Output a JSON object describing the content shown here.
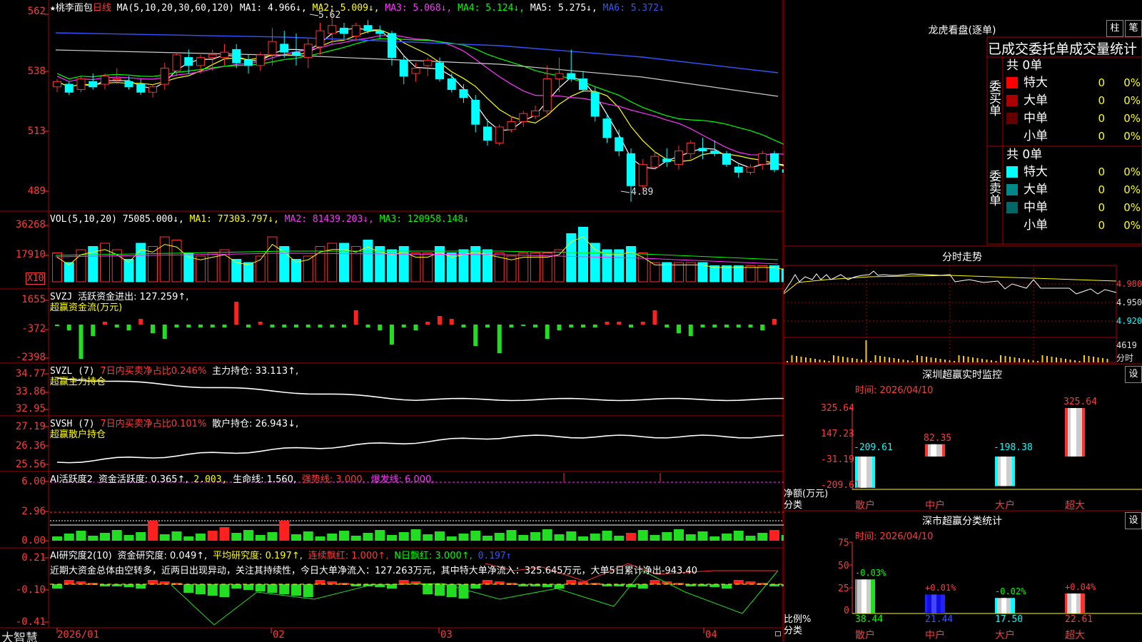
{
  "colors": {
    "up": "#ff3030",
    "down": "#00ffff",
    "ma1": "#ffffff",
    "ma2": "#ffff00",
    "ma3": "#ff33ff",
    "ma4": "#00ff00",
    "ma5": "#cccccc",
    "ma6": "#3355ff",
    "grid": "#880000"
  },
  "main": {
    "star_icon": "star-icon",
    "stock_name": "★桃李面包",
    "period": "日线",
    "ma_label": "MA(5,10,20,30,60,120)",
    "ma1": "MA1: 4.966↓,",
    "ma2": "MA2: 5.009↓,",
    "ma3": "MA3: 5.068↓,",
    "ma4": "MA4: 5.124↓,",
    "ma5": "MA5: 5.275↓,",
    "ma6": "MA6: 5.372↓",
    "y_ticks": [
      "562",
      "538",
      "513",
      "489"
    ],
    "high_marker": "5.62",
    "low_marker": "4.89"
  },
  "chart_data": [
    {
      "type": "candlestick",
      "title": "桃李面包 日线",
      "ylim": [
        4.86,
        5.64
      ],
      "ohlc_approx": [
        [
          5.32,
          5.35,
          5.3,
          5.34
        ],
        [
          5.33,
          5.34,
          5.29,
          5.3
        ],
        [
          5.31,
          5.36,
          5.3,
          5.35
        ],
        [
          5.34,
          5.37,
          5.31,
          5.32
        ],
        [
          5.33,
          5.37,
          5.31,
          5.36
        ],
        [
          5.35,
          5.39,
          5.33,
          5.35
        ],
        [
          5.34,
          5.36,
          5.31,
          5.32
        ],
        [
          5.33,
          5.35,
          5.29,
          5.3
        ],
        [
          5.3,
          5.33,
          5.28,
          5.32
        ],
        [
          5.33,
          5.41,
          5.31,
          5.39
        ],
        [
          5.38,
          5.45,
          5.36,
          5.44
        ],
        [
          5.43,
          5.46,
          5.37,
          5.4
        ],
        [
          5.4,
          5.44,
          5.37,
          5.43
        ],
        [
          5.43,
          5.46,
          5.38,
          5.44
        ],
        [
          5.43,
          5.48,
          5.4,
          5.45
        ],
        [
          5.46,
          5.48,
          5.39,
          5.41
        ],
        [
          5.42,
          5.44,
          5.37,
          5.4
        ],
        [
          5.4,
          5.45,
          5.38,
          5.44
        ],
        [
          5.44,
          5.54,
          5.4,
          5.49
        ],
        [
          5.48,
          5.53,
          5.43,
          5.45
        ],
        [
          5.45,
          5.52,
          5.4,
          5.44
        ],
        [
          5.43,
          5.5,
          5.39,
          5.48
        ],
        [
          5.47,
          5.56,
          5.44,
          5.53
        ],
        [
          5.52,
          5.62,
          5.48,
          5.55
        ],
        [
          5.54,
          5.56,
          5.5,
          5.52
        ],
        [
          5.51,
          5.56,
          5.49,
          5.55
        ],
        [
          5.55,
          5.57,
          5.52,
          5.53
        ],
        [
          5.53,
          5.55,
          5.5,
          5.52
        ],
        [
          5.52,
          5.53,
          5.4,
          5.43
        ],
        [
          5.42,
          5.44,
          5.33,
          5.36
        ],
        [
          5.37,
          5.41,
          5.34,
          5.39
        ],
        [
          5.4,
          5.43,
          5.36,
          5.42
        ],
        [
          5.41,
          5.43,
          5.34,
          5.35
        ],
        [
          5.35,
          5.37,
          5.3,
          5.31
        ],
        [
          5.31,
          5.33,
          5.26,
          5.28
        ],
        [
          5.27,
          5.29,
          5.15,
          5.18
        ],
        [
          5.17,
          5.2,
          5.1,
          5.12
        ],
        [
          5.11,
          5.18,
          5.1,
          5.17
        ],
        [
          5.16,
          5.21,
          5.15,
          5.19
        ],
        [
          5.19,
          5.23,
          5.17,
          5.22
        ],
        [
          5.21,
          5.25,
          5.2,
          5.23
        ],
        [
          5.23,
          5.4,
          5.21,
          5.35
        ],
        [
          5.35,
          5.43,
          5.3,
          5.37
        ],
        [
          5.37,
          5.46,
          5.34,
          5.35
        ],
        [
          5.35,
          5.38,
          5.3,
          5.31
        ],
        [
          5.3,
          5.32,
          5.19,
          5.21
        ],
        [
          5.2,
          5.22,
          5.11,
          5.13
        ],
        [
          5.13,
          5.16,
          5.06,
          5.08
        ],
        [
          5.07,
          5.09,
          4.89,
          4.95
        ],
        [
          4.95,
          5.05,
          4.93,
          5.03
        ],
        [
          5.02,
          5.08,
          5.01,
          5.06
        ],
        [
          5.05,
          5.09,
          5.02,
          5.04
        ],
        [
          5.03,
          5.1,
          5.01,
          5.08
        ],
        [
          5.07,
          5.12,
          5.05,
          5.11
        ],
        [
          5.09,
          5.13,
          5.05,
          5.08
        ],
        [
          5.08,
          5.12,
          5.06,
          5.07
        ],
        [
          5.07,
          5.08,
          5.02,
          5.03
        ],
        [
          5.02,
          5.03,
          4.98,
          5.0
        ],
        [
          5.0,
          5.03,
          4.99,
          5.02
        ],
        [
          5.03,
          5.08,
          5.01,
          5.07
        ],
        [
          5.07,
          5.08,
          5.0,
          5.01
        ],
        [
          5.01,
          5.03,
          4.99,
          5.0
        ]
      ]
    },
    {
      "type": "bar",
      "title": "VOL(5,10,20)",
      "values_rel": [
        0.45,
        0.3,
        0.5,
        0.55,
        0.6,
        0.5,
        0.35,
        0.6,
        0.55,
        0.7,
        0.65,
        0.45,
        0.4,
        0.45,
        0.5,
        0.35,
        0.3,
        0.4,
        0.7,
        0.55,
        0.35,
        0.4,
        0.55,
        0.6,
        0.6,
        0.55,
        0.65,
        0.55,
        0.5,
        0.55,
        0.45,
        0.45,
        0.55,
        0.45,
        0.5,
        0.55,
        0.5,
        0.45,
        0.4,
        0.45,
        0.45,
        0.45,
        0.5,
        0.75,
        0.85,
        0.6,
        0.5,
        0.5,
        0.55,
        0.45,
        0.3,
        0.3,
        0.3,
        0.3,
        0.3,
        0.25,
        0.25,
        0.25,
        0.25,
        0.25,
        0.25,
        0.2
      ],
      "y_ticks": [
        "36268",
        "17910"
      ],
      "unit": "X10"
    }
  ],
  "vol": {
    "label": "VOL(5,10,20)",
    "value": "75085.000↓,",
    "ma1": "MA1: 77303.797↓,",
    "ma2": "MA2: 81439.203↓,",
    "ma3": "MA3: 120958.148↓",
    "y_ticks": [
      "36268",
      "17910"
    ],
    "unit": "X10"
  },
  "svzj": {
    "label": "SVZJ",
    "desc": "活跃资金进出: 127.259↑,",
    "sub": "超赢资金流(万元)",
    "y_ticks": [
      "1655",
      "-372",
      "-2398"
    ]
  },
  "svzl": {
    "label": "SVZL (7)",
    "desc1": "7日内买卖净占比0.246%",
    "desc2": "主力持仓: 33.113↑,",
    "sub": "超赢主力持仓",
    "y_ticks": [
      "34.77",
      "33.86",
      "32.95"
    ]
  },
  "svsh": {
    "label": "SVSH (7)",
    "desc1": "7日内买卖净占比0.101%",
    "desc2": "散户持仓: 26.943↓,",
    "sub": "超赢散户持仓",
    "y_ticks": [
      "27.19",
      "26.36",
      "25.56"
    ]
  },
  "ai_active": {
    "label": "AI活跃度2",
    "d1": "资金活跃度: 0.365↑,",
    "d2": "2.003,",
    "d3": "生命线: 1.560,",
    "d4": "强势线: 3.000,",
    "d5": "爆发线: 6.000,",
    "y_ticks": [
      "6.00",
      "2.96",
      "0.00"
    ]
  },
  "ai_research": {
    "label": "AI研究度2(10)",
    "d1": "资金研究度: 0.049↑,",
    "d2": "平均研究度: 0.197↑,",
    "d3": "连续飘红: 1.000↑,",
    "d4": "N日飘红: 3.000↑,",
    "d5": "0.197↑",
    "note": "近期大资金总体由空转多，近两日出现异动，关注其持续性，今日大单净流入：127.263万元，其中特大单净流入：325.645万元，大单5日累计净出-943.40",
    "y_ticks": [
      "0.21",
      "-0.10",
      "-0.41"
    ]
  },
  "x_axis": {
    "labels": [
      "2026/01",
      "02",
      "03",
      "04"
    ],
    "brand": "大智慧"
  },
  "right": {
    "longhu_title": "龙虎看盘(逐单)",
    "btn_column": "柱",
    "btn_count": "笔",
    "stat_title": "已成交委托单成交量统计",
    "buy_side": "委买单",
    "sell_side": "委卖单",
    "buy_total": "共 0单",
    "sell_total": "共 0单",
    "buy_rows": [
      {
        "label": "特大",
        "count": "0",
        "pct": "0%",
        "color": "#ff0000"
      },
      {
        "label": "大单",
        "count": "0",
        "pct": "0%",
        "color": "#aa0000"
      },
      {
        "label": "中单",
        "count": "0",
        "pct": "0%",
        "color": "#660000"
      },
      {
        "label": "小单",
        "count": "0",
        "pct": "0%",
        "color": "#000000"
      }
    ],
    "sell_rows": [
      {
        "label": "特大",
        "count": "0",
        "pct": "0%",
        "color": "#00ffff"
      },
      {
        "label": "大单",
        "count": "0",
        "pct": "0%",
        "color": "#008888"
      },
      {
        "label": "中单",
        "count": "0",
        "pct": "0%",
        "color": "#006666"
      },
      {
        "label": "小单",
        "count": "0",
        "pct": "0%",
        "color": "#000000"
      }
    ],
    "intraday_title": "分时走势",
    "intraday_ticks": [
      "4.980",
      "4.950",
      "4.920"
    ],
    "intraday_vol": "4619",
    "intraday_vol_unit": "分时",
    "sz_title": "深圳超赢实时监控",
    "sz_btn": "设",
    "sz_time": "时间: 2026/04/10",
    "sz_y_ticks": [
      "325.64",
      "147.23",
      "-31.19",
      "-209.61"
    ],
    "sz_ylabel": "净额(万元)",
    "sz_xlabel": "分类",
    "sz_cats": [
      "散户",
      "中户",
      "大户",
      "超大"
    ],
    "sz_vals": [
      "-209.61",
      "82.35",
      "-198.38",
      "325.64"
    ],
    "cls_title": "深市超赢分类统计",
    "cls_btn": "设",
    "cls_time": "时间: 2026/04/10",
    "cls_y_ticks": [
      "75",
      "50",
      "25",
      "0"
    ],
    "cls_ylabel": "比例%",
    "cls_xlabel": "分类",
    "cls_cats": [
      "散户",
      "中户",
      "大户",
      "超大"
    ],
    "cls_top": [
      "-0.03%",
      "+0.01%",
      "-0.02%",
      "+0.04%"
    ],
    "cls_vals": [
      "38.44",
      "21.44",
      "17.50",
      "22.61"
    ]
  }
}
